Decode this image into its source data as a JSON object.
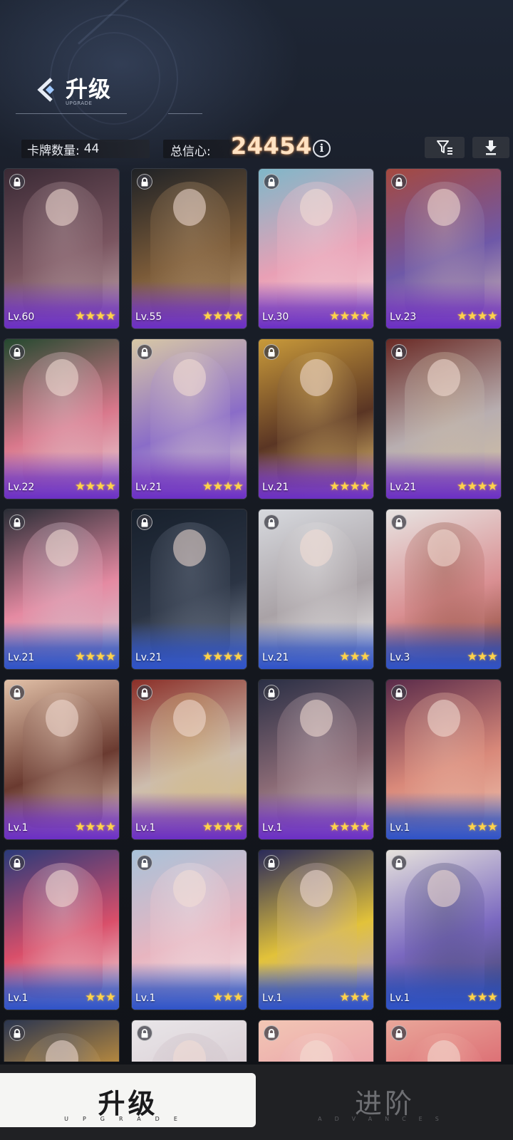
{
  "header": {
    "title": "升级",
    "subtitle": "UPGRADE"
  },
  "stats": {
    "card_count_label": "卡牌数量:",
    "card_count_value": "44",
    "confidence_label": "总信心:",
    "confidence_value": "24454",
    "info_glyph": "i"
  },
  "icons": {
    "back": "back-chevron-icon",
    "filter": "filter-icon",
    "download": "download-icon",
    "info": "info-icon",
    "lock": "lock-icon",
    "star": "star-icon"
  },
  "colors": {
    "confidence_value": "#ffe2c2",
    "star": "#ffd34a",
    "rarity_purple": "#6b2fc4",
    "rarity_blue": "#2f53c8",
    "active_tab_bg": "#f5f5f3"
  },
  "cards": [
    {
      "level": "Lv.60",
      "stars": 4,
      "rarity": "purple",
      "palette": [
        "#3a2a35",
        "#7a5560",
        "#c9b0b5"
      ]
    },
    {
      "level": "Lv.55",
      "stars": 4,
      "rarity": "purple",
      "palette": [
        "#1f2226",
        "#7a5a38",
        "#c0a07a"
      ]
    },
    {
      "level": "Lv.30",
      "stars": 4,
      "rarity": "purple",
      "palette": [
        "#7fb7c9",
        "#e9a0b5",
        "#f3d9df"
      ]
    },
    {
      "level": "Lv.23",
      "stars": 4,
      "rarity": "purple",
      "palette": [
        "#a5493f",
        "#6e58a8",
        "#d9c0b3"
      ]
    },
    {
      "level": "Lv.22",
      "stars": 4,
      "rarity": "purple",
      "palette": [
        "#24492f",
        "#d9788c",
        "#e9dfe3"
      ]
    },
    {
      "level": "Lv.21",
      "stars": 4,
      "rarity": "purple",
      "palette": [
        "#d8c8a5",
        "#8a6cc8",
        "#f1e3cc"
      ]
    },
    {
      "level": "Lv.21",
      "stars": 4,
      "rarity": "purple",
      "palette": [
        "#c99a3a",
        "#5a3524",
        "#f3d27a"
      ]
    },
    {
      "level": "Lv.21",
      "stars": 4,
      "rarity": "purple",
      "palette": [
        "#6a2a25",
        "#b8aeb0",
        "#d7c3a0"
      ]
    },
    {
      "level": "Lv.21",
      "stars": 4,
      "rarity": "blue",
      "palette": [
        "#2a2d36",
        "#e58aa2",
        "#cfd3dc"
      ]
    },
    {
      "level": "Lv.21",
      "stars": 4,
      "rarity": "blue",
      "palette": [
        "#17202c",
        "#2b3444",
        "#8a94a6"
      ]
    },
    {
      "level": "Lv.21",
      "stars": 3,
      "rarity": "blue",
      "palette": [
        "#d7d9de",
        "#a9a2a6",
        "#f3f2f2"
      ]
    },
    {
      "level": "Lv.3",
      "stars": 3,
      "rarity": "blue",
      "palette": [
        "#e7e4e2",
        "#d98f92",
        "#7a3a25"
      ]
    },
    {
      "level": "Lv.1",
      "stars": 4,
      "rarity": "purple",
      "palette": [
        "#e2c1a8",
        "#6a3a30",
        "#f3dccb"
      ]
    },
    {
      "level": "Lv.1",
      "stars": 4,
      "rarity": "purple",
      "palette": [
        "#8b2f28",
        "#cdbdae",
        "#d9b96a"
      ]
    },
    {
      "level": "Lv.1",
      "stars": 4,
      "rarity": "purple",
      "palette": [
        "#2a2f45",
        "#8a6a75",
        "#d9c9cf"
      ]
    },
    {
      "level": "Lv.1",
      "stars": 3,
      "rarity": "blue",
      "palette": [
        "#5a2b4a",
        "#d9897a",
        "#f0c9b5"
      ]
    },
    {
      "level": "Lv.1",
      "stars": 3,
      "rarity": "blue",
      "palette": [
        "#2a3a7a",
        "#d94f6a",
        "#f3f0f0"
      ]
    },
    {
      "level": "Lv.1",
      "stars": 3,
      "rarity": "blue",
      "palette": [
        "#a9c2d9",
        "#e8b5c0",
        "#f2eef0"
      ]
    },
    {
      "level": "Lv.1",
      "stars": 3,
      "rarity": "blue",
      "palette": [
        "#2a2a5a",
        "#e2c23a",
        "#b7a3e0"
      ]
    },
    {
      "level": "Lv.1",
      "stars": 3,
      "rarity": "blue",
      "palette": [
        "#e6e2dc",
        "#7a68c0",
        "#3a3f5a"
      ]
    },
    {
      "level": "",
      "stars": 0,
      "rarity": "blue",
      "palette": [
        "#2a3550",
        "#e0a23a",
        "#6a7aa0"
      ]
    },
    {
      "level": "",
      "stars": 0,
      "rarity": "blue",
      "palette": [
        "#e9e6e9",
        "#d6c9cf",
        "#c6b8c0"
      ]
    },
    {
      "level": "",
      "stars": 0,
      "rarity": "blue",
      "palette": [
        "#f2c7b5",
        "#e99aa6",
        "#f6e1d8"
      ]
    },
    {
      "level": "",
      "stars": 0,
      "rarity": "blue",
      "palette": [
        "#e9a79a",
        "#d95f6a",
        "#f4c9b8"
      ]
    }
  ],
  "tabs": {
    "upgrade_label": "升级",
    "upgrade_sub": "UPGRADE",
    "advance_label": "进阶",
    "advance_sub": "ADVANCES"
  }
}
